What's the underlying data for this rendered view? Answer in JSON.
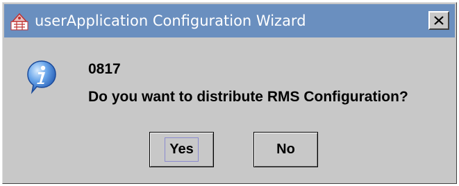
{
  "window": {
    "title": "userApplication Configuration Wizard",
    "close_label": "×"
  },
  "dialog": {
    "message_code": "0817",
    "message": "Do you want to distribute RMS Configuration?",
    "icon": "information-icon"
  },
  "buttons": {
    "yes_label": "Yes",
    "no_label": "No",
    "focused": "Yes"
  },
  "colors": {
    "titlebar": "#6a8fbf",
    "dialog_background": "#c8c8c8",
    "info_icon": "#2f6fcf"
  }
}
